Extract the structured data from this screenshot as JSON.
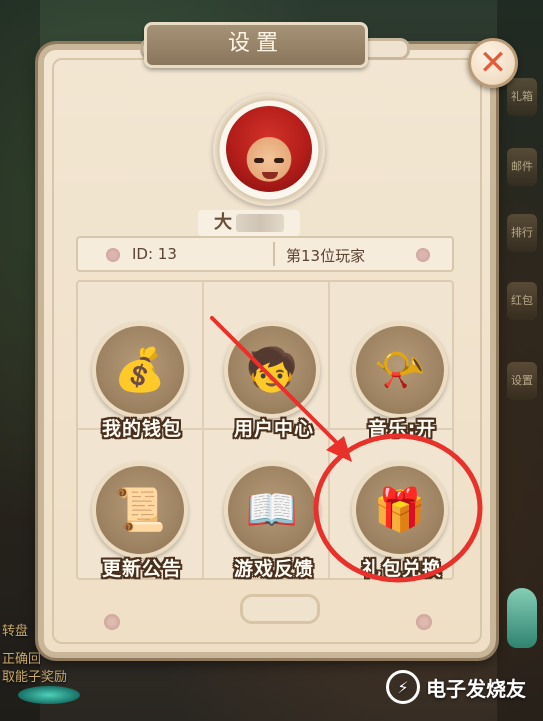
{
  "dialog": {
    "title": "设置",
    "close_icon_glyph": "✕"
  },
  "profile": {
    "name_visible": "大",
    "id_text": "ID: 13",
    "rank_text": "第13位玩家"
  },
  "tiles": [
    {
      "label": "我的钱包",
      "icon": "wallet-bag-icon",
      "glyph": "💰"
    },
    {
      "label": "用户中心",
      "icon": "user-center-icon",
      "glyph": "🧒"
    },
    {
      "label": "音乐:开",
      "icon": "music-horn-icon",
      "glyph": "📯"
    },
    {
      "label": "更新公告",
      "icon": "scroll-notice-icon",
      "glyph": "📜"
    },
    {
      "label": "游戏反馈",
      "icon": "feedback-book-icon",
      "glyph": "📖"
    },
    {
      "label": "礼包兑换",
      "icon": "gift-bag-icon",
      "glyph": "🎁"
    }
  ],
  "side_menu": [
    "礼箱",
    "邮件",
    "排行",
    "红包",
    "设置"
  ],
  "background_text": [
    "转盘",
    "正确回",
    "取能子奖励"
  ],
  "watermark": {
    "text": "电子发烧友",
    "logo_glyph": "⚡"
  },
  "colors": {
    "annotation_red": "#e8312b",
    "label_outline": "#4a2f1c",
    "close_x": "#e45b3b"
  }
}
